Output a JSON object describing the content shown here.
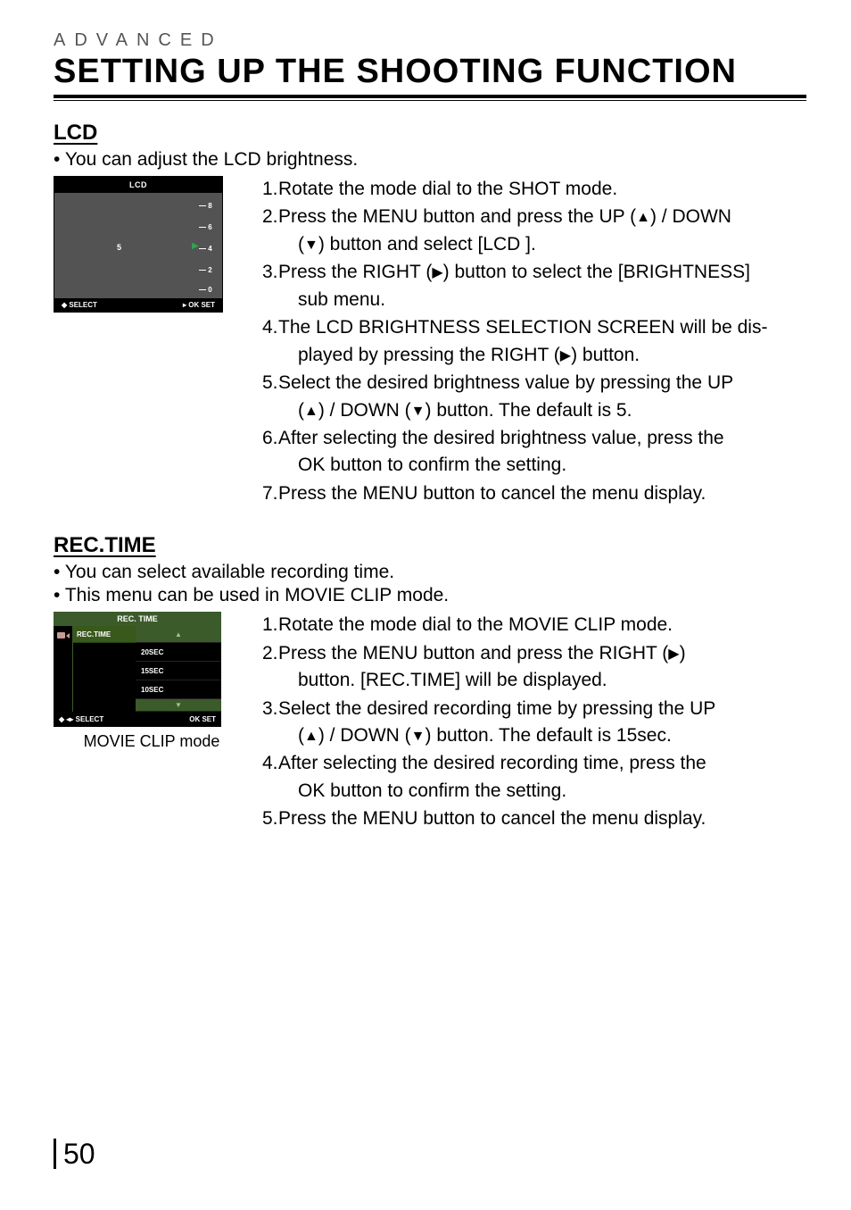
{
  "header": {
    "section_label": "ADVANCED",
    "title": "SETTING UP THE SHOOTING FUNCTION"
  },
  "lcd": {
    "heading": "LCD",
    "bullet1": "You can adjust the LCD brightness.",
    "screenshot": {
      "title": "LCD",
      "value": "5",
      "scale": {
        "t8": "8",
        "t6": "6",
        "t4": "4",
        "t2": "2",
        "t0": "0"
      },
      "foot_left": "SELECT",
      "foot_right": "OK  SET"
    },
    "steps": {
      "s1": "Rotate the mode dial to the SHOT mode.",
      "s2a": "Press the MENU button and press the UP (",
      "s2b": ") / DOWN",
      "s2c": "(",
      "s2d": ") button and select [LCD ].",
      "s3a": "Press the RIGHT (",
      "s3b": ") button to select the [BRIGHTNESS]",
      "s3c": "sub menu.",
      "s4a": "The LCD BRIGHTNESS SELECTION SCREEN will be dis-",
      "s4b": "played by pressing the RIGHT (",
      "s4c": ")  button.",
      "s5a": "Select the desired brightness value by pressing the UP",
      "s5b": "(",
      "s5c": ") / DOWN (",
      "s5d": ") button. The default is 5.",
      "s6a": "After selecting the desired brightness value, press the",
      "s6b": "OK button to confirm the setting.",
      "s7": "Press the MENU button to cancel the menu display."
    }
  },
  "rec": {
    "heading": "REC.TIME",
    "bullet1": "You can select available recording time.",
    "bullet2": "This menu can be used in MOVIE CLIP mode.",
    "screenshot": {
      "title": "REC. TIME",
      "tab": "REC.TIME",
      "opt1": "20SEC",
      "opt2": "15SEC",
      "opt3": "10SEC",
      "foot_left": "SELECT",
      "foot_right": "OK  SET"
    },
    "caption": "MOVIE CLIP mode",
    "steps": {
      "s1": "Rotate the mode dial to the MOVIE CLIP mode.",
      "s2a": "Press the MENU button and press the RIGHT (",
      "s2b": ")",
      "s2c": "button. [REC.TIME] will be displayed.",
      "s3a": "Select the desired recording time by pressing the UP",
      "s3b": "(",
      "s3c": ") / DOWN (",
      "s3d": ") button. The default is 15sec.",
      "s4a": "After selecting the desired recording time, press the",
      "s4b": "OK button to confirm the setting.",
      "s5": "Press the MENU button to cancel the menu display."
    }
  },
  "page_number": "50"
}
